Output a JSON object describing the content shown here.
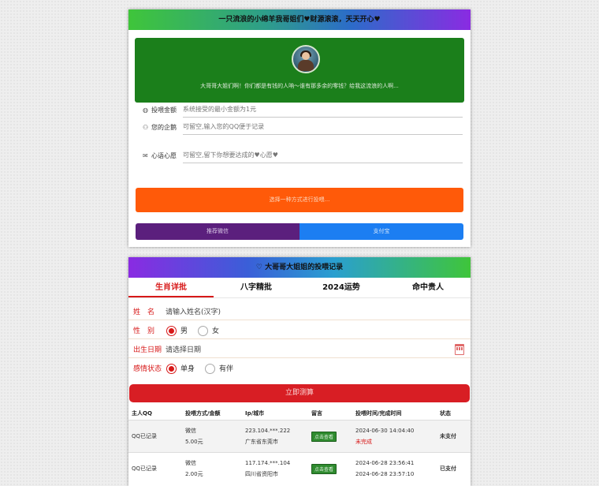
{
  "card1": {
    "header": "一只流浪的小绵羊我哥姐们♥财源滚滚，天天开心♥",
    "green_text": "大哥哥大姐们啊！你们都是有钱的人呐～谁有那多余的零钱？给我这流浪的人啊...",
    "fields": [
      {
        "icon": "coin-icon",
        "label": "投喂金额",
        "placeholder": "系统接受的最小金额为1元"
      },
      {
        "icon": "user-icon",
        "label": "您的企鹅",
        "placeholder": "可留空,输入您的QQ便于记录"
      },
      {
        "icon": "mail-icon",
        "label": "心语心愿",
        "placeholder": "可留空,留下你想要达成的♥心愿♥"
      }
    ],
    "choose_button": "选择一种方式进行投喂...",
    "pay_wechat": "推荐微信",
    "pay_alipay": "支付宝"
  },
  "card2": {
    "header": "♡ 大哥哥大姐姐的投喂记录",
    "tabs": [
      "生肖详批",
      "八字精批",
      "2024运势",
      "命中贵人"
    ],
    "form": {
      "name_label": "姓　名",
      "name_placeholder": "请输入姓名(汉字)",
      "gender_label": "性　别",
      "gender_male": "男",
      "gender_female": "女",
      "birth_label": "出生日期",
      "birth_placeholder": "请选择日期",
      "status_label": "感情状态",
      "status_single": "单身",
      "status_partner": "有伴"
    },
    "submit": "立即测算",
    "table": {
      "headers": [
        "主人QQ",
        "投喂方式/金额",
        "Ip/城市",
        "留言",
        "投喂时间/完成时间",
        "状态"
      ],
      "rows": [
        {
          "qq": "QQ已记录",
          "method": "微信",
          "amount": "5.00元",
          "ip": "223.104.***.222",
          "city": "广东省东莞市",
          "msg_btn": "点击查看",
          "time": "2024-06-30 14:04:40",
          "done": "未完成",
          "status": "未支付"
        },
        {
          "qq": "QQ已记录",
          "method": "微信",
          "amount": "2.00元",
          "ip": "117.174.***.104",
          "city": "四川省资阳市",
          "msg_btn": "点击查看",
          "time": "2024-06-28 23:56:41",
          "done": "2024-06-28 23:57:10",
          "status": "已支付"
        }
      ]
    }
  },
  "colors": {
    "accent_orange": "#ff5a09",
    "accent_red": "#d81e24",
    "wechat": "#5b1f7d",
    "alipay": "#1c7ef2",
    "green_box": "#1b7f1b"
  }
}
